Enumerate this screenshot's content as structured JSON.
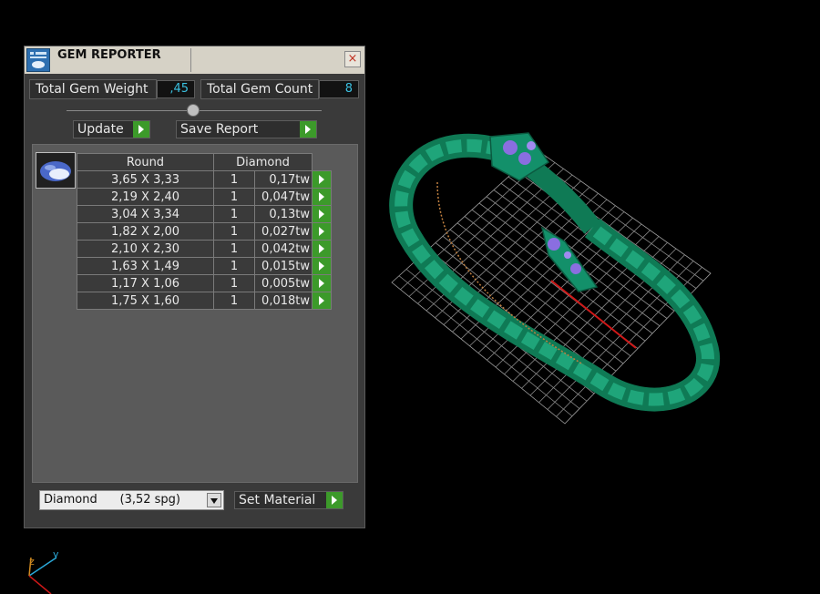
{
  "window": {
    "title": "GEM REPORTER",
    "close_label": "×"
  },
  "stats": {
    "weight_label": "Total Gem Weight",
    "weight_value": ",45",
    "count_label": "Total Gem Count",
    "count_value": "8"
  },
  "buttons": {
    "update": "Update",
    "save_report": "Save Report",
    "set_material": "Set Material"
  },
  "table": {
    "header_shape": "Round",
    "header_material": "Diamond",
    "rows": [
      {
        "size": "3,65 X 3,33",
        "qty": "1",
        "weight": "0,17tw"
      },
      {
        "size": "2,19 X 2,40",
        "qty": "1",
        "weight": "0,047tw"
      },
      {
        "size": "3,04 X 3,34",
        "qty": "1",
        "weight": "0,13tw"
      },
      {
        "size": "1,82 X 2,00",
        "qty": "1",
        "weight": "0,027tw"
      },
      {
        "size": "2,10 X 2,30",
        "qty": "1",
        "weight": "0,042tw"
      },
      {
        "size": "1,63 X 1,49",
        "qty": "1",
        "weight": "0,015tw"
      },
      {
        "size": "1,17 X 1,06",
        "qty": "1",
        "weight": "0,005tw"
      },
      {
        "size": "1,75 X 1,60",
        "qty": "1",
        "weight": "0,018tw"
      }
    ]
  },
  "material": {
    "selected": "Diamond      (3,52 spg)"
  },
  "axis": {
    "y": "y",
    "z": "z"
  },
  "colors": {
    "accent_green": "#3c9a2a",
    "value_cyan": "#3ac0e0",
    "model_green": "#148a62"
  }
}
